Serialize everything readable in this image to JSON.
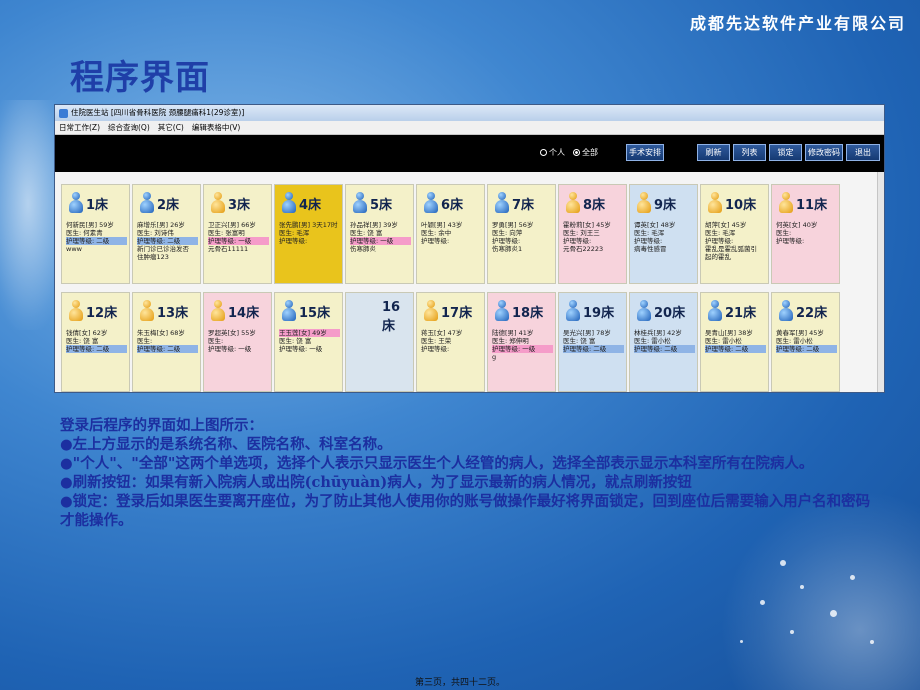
{
  "slide": {
    "company": "成都先达软件产业有限公司",
    "title": "程序界面",
    "footer": "第三页，共四十二页。"
  },
  "app": {
    "window_title": "住院医生站 [四川省骨科医院 颈腰腿痛科1(29诊室)]",
    "menu": [
      "日常工作(Z)",
      "综合查询(Q)",
      "其它(C)",
      "编辑表格中(V)"
    ],
    "radios": [
      {
        "label": "个人",
        "checked": false
      },
      {
        "label": "全部",
        "checked": true
      }
    ],
    "buttons": {
      "surgery": "手术安排",
      "refresh": "刷新",
      "list": "列表",
      "lock": "锁定",
      "change_password": "修改密码",
      "exit": "退出"
    },
    "beds_row1": [
      {
        "bed": "1床",
        "gender": "male",
        "color": "yellow",
        "lines": [
          "何新民[男] 59岁",
          "医生: 何素青",
          "护理等级: 二级",
          "www"
        ],
        "tag_line": 2,
        "tag": "blue"
      },
      {
        "bed": "2床",
        "gender": "male",
        "color": "yellow",
        "lines": [
          "麻增乐[男] 26岁",
          "医生: 刘诗伟",
          "护理等级: 二级",
          "新门诊已诊治发否",
          "住肿瘤123"
        ],
        "tag_line": 2,
        "tag": "blue"
      },
      {
        "bed": "3床",
        "gender": "female",
        "color": "yellow",
        "lines": [
          "卫正兴[男] 66岁",
          "医生: 张富明",
          "护理等级: 一级",
          "元骨石11111"
        ],
        "tag_line": 2,
        "tag": "pink"
      },
      {
        "bed": "4床",
        "gender": "male",
        "color": "gold",
        "lines": [
          "张先鹏[男] 3天17时",
          "医生: 毛浑",
          "护理等级:",
          ""
        ],
        "tag_line": -1,
        "tag": ""
      },
      {
        "bed": "5床",
        "gender": "male",
        "color": "yellow",
        "lines": [
          "孙品祥[男] 39岁",
          "医生: 饶 富",
          "护理等级: 一级",
          "伤寒肺炎"
        ],
        "tag_line": 2,
        "tag": "pink"
      },
      {
        "bed": "6床",
        "gender": "male",
        "color": "yellow",
        "lines": [
          "叶颖[男] 43岁",
          "医生: 余中",
          "护理等级:",
          ""
        ],
        "tag_line": -1,
        "tag": ""
      },
      {
        "bed": "7床",
        "gender": "male",
        "color": "yellow",
        "lines": [
          "罗勇[男] 56岁",
          "医生: 向萍",
          "护理等级:",
          "伤寒肺炎1"
        ],
        "tag_line": -1,
        "tag": ""
      },
      {
        "bed": "8床",
        "gender": "female",
        "color": "pink",
        "lines": [
          "霍粉莉[女] 45岁",
          "医生: 刘王三",
          "护理等级:",
          "元骨石22223"
        ],
        "tag_line": -1,
        "tag": ""
      },
      {
        "bed": "9床",
        "gender": "female",
        "color": "blue",
        "lines": [
          "谭英[女] 48岁",
          "医生: 毛浑",
          "护理等级:",
          "病毒性感冒"
        ],
        "tag_line": -1,
        "tag": ""
      },
      {
        "bed": "10床",
        "gender": "female",
        "color": "yellow",
        "lines": [
          "胡萍[女] 45岁",
          "医生: 毛浑",
          "护理等级:",
          "霍乱是霍乱弧菌引",
          "起的霍乱"
        ],
        "tag_line": -1,
        "tag": ""
      },
      {
        "bed": "11床",
        "gender": "female",
        "color": "pink",
        "lines": [
          "何英[女] 40岁",
          "医生:",
          "护理等级:",
          ""
        ],
        "tag_line": -1,
        "tag": ""
      }
    ],
    "beds_row2": [
      {
        "bed": "12床",
        "gender": "female",
        "color": "yellow",
        "lines": [
          "钱倩[女] 62岁",
          "医生: 饶 富",
          "护理等级: 二级"
        ],
        "tag_line": 2,
        "tag": "blue"
      },
      {
        "bed": "13床",
        "gender": "female",
        "color": "yellow",
        "lines": [
          "朱玉梅[女] 68岁",
          "医生:",
          "护理等级: 二级"
        ],
        "tag_line": 2,
        "tag": "blue"
      },
      {
        "bed": "14床",
        "gender": "female",
        "color": "pink",
        "lines": [
          "罗超英[女] 55岁",
          "医生:",
          "护理等级: 一级"
        ],
        "tag_line": -1,
        "tag": ""
      },
      {
        "bed": "15床",
        "gender": "male",
        "color": "yellow",
        "lines": [
          "王玉莲[女] 49岁",
          "医生: 饶 富",
          "护理等级: 一级"
        ],
        "tag_line": 0,
        "tag": "pink"
      },
      {
        "bed": "16床",
        "gender": "none",
        "color": "grey",
        "lines": [],
        "tag_line": -1,
        "tag": ""
      },
      {
        "bed": "17床",
        "gender": "female",
        "color": "yellow",
        "lines": [
          "蒋玉[女] 47岁",
          "医生: 王荣",
          "护理等级:"
        ],
        "tag_line": -1,
        "tag": ""
      },
      {
        "bed": "18床",
        "gender": "male",
        "color": "pink",
        "lines": [
          "陆德[男] 41岁",
          "医生: 郑伸明",
          "护理等级: 一级",
          "g"
        ],
        "tag_line": 2,
        "tag": "pink"
      },
      {
        "bed": "19床",
        "gender": "male",
        "color": "blue",
        "lines": [
          "吴光兴[男] 78岁",
          "医生: 饶 富",
          "护理等级: 二级"
        ],
        "tag_line": 2,
        "tag": "blue"
      },
      {
        "bed": "20床",
        "gender": "male",
        "color": "blue",
        "lines": [
          "林桂兵[男] 42岁",
          "医生: 雷小松",
          "护理等级: 二级"
        ],
        "tag_line": 2,
        "tag": "blue"
      },
      {
        "bed": "21床",
        "gender": "male",
        "color": "yellow",
        "lines": [
          "吴青山[男] 38岁",
          "医生: 雷小松",
          "护理等级: 二级"
        ],
        "tag_line": 2,
        "tag": "blue"
      },
      {
        "bed": "22床",
        "gender": "male",
        "color": "yellow",
        "lines": [
          "黄春军[男] 45岁",
          "医生: 雷小松",
          "护理等级: 二级"
        ],
        "tag_line": 2,
        "tag": "blue"
      }
    ]
  },
  "description": [
    "登录后程序的界面如上图所示：",
    "●左上方显示的是系统名称、医院名称、科室名称。",
    "●\"个人\"、\"全部\"这两个单选项，选择个人表示只显示医生个人经管的病人，选择全部表示显示本科室所有在院病人。",
    "●刷新按钮：如果有新入院病人或出院(chūyuàn)病人，为了显示最新的病人情况，就点刷新按钮",
    "●锁定：登录后如果医生要离开座位，为了防止其他人使用你的账号做操作最好将界面锁定，回到座位后需要输入用户名和密码才能操作。"
  ]
}
